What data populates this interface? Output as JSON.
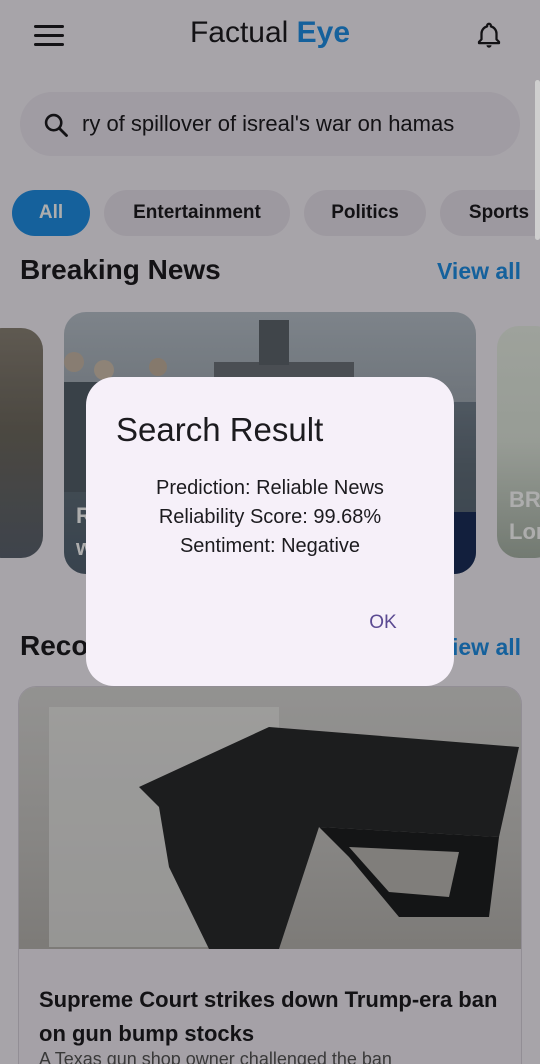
{
  "header": {
    "title_part1": "Factual ",
    "title_part2": "Eye",
    "accent_color": "#1f8fe6",
    "menu_icon": "hamburger-menu-icon",
    "notification_icon": "bell-icon"
  },
  "search": {
    "value": "ry of spillover of isreal's war on hamas",
    "icon": "search-icon"
  },
  "categories": [
    {
      "label": "All",
      "active": true
    },
    {
      "label": "Entertainment",
      "active": false
    },
    {
      "label": "Politics",
      "active": false
    },
    {
      "label": "Sports",
      "active": false
    }
  ],
  "breaking": {
    "title": "Breaking News",
    "view_all": "View all",
    "cards": [
      {
        "caption": "R\nw"
      },
      {
        "caption": ""
      },
      {
        "caption": "BR\nLor"
      }
    ]
  },
  "recommended": {
    "title": "Reco",
    "view_all": "iew all",
    "article": {
      "headline": "Supreme Court strikes down Trump-era ban on gun bump stocks",
      "summary": "A Texas gun shop owner challenged the ban"
    }
  },
  "dialog": {
    "title": "Search Result",
    "prediction": "Prediction: Reliable News",
    "score": "Reliability Score: 99.68%",
    "sentiment": "Sentiment: Negative",
    "ok_label": "OK"
  }
}
